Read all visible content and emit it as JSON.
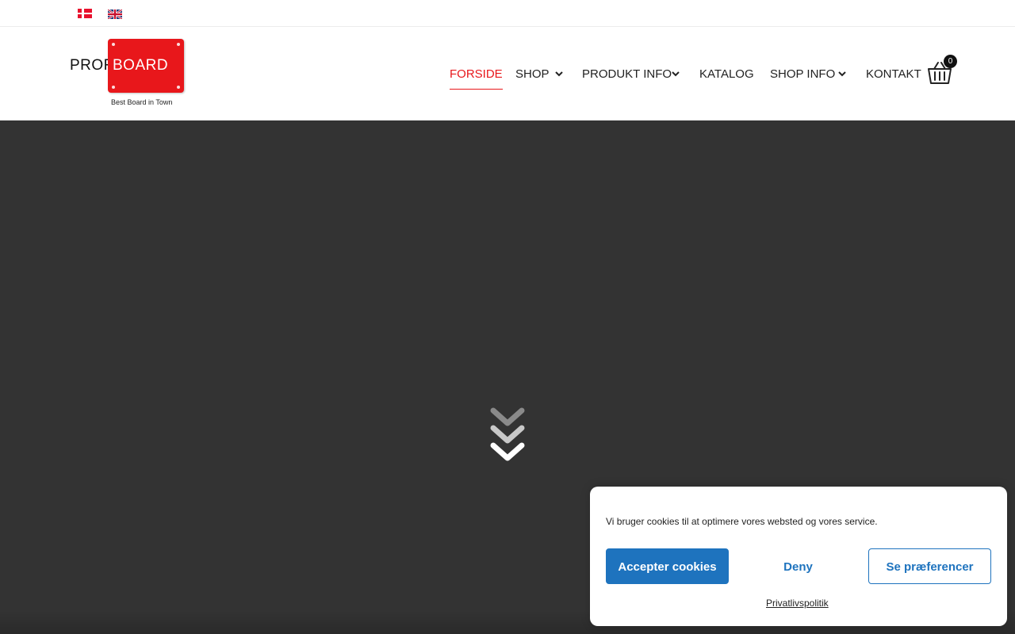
{
  "languages": [
    {
      "code": "da",
      "icon": "danish-flag-icon"
    },
    {
      "code": "en",
      "icon": "uk-flag-icon"
    }
  ],
  "logo": {
    "prefix": "PROF",
    "board": "BOARD",
    "tagline": "Best Board in Town",
    "brand_color": "#e8171b"
  },
  "nav": {
    "items": [
      {
        "label": "FORSIDE",
        "active": true,
        "dropdown": false
      },
      {
        "label": "SHOP",
        "active": false,
        "dropdown": true
      },
      {
        "label": "PRODUKT INFO",
        "active": false,
        "dropdown": true
      },
      {
        "label": "KATALOG",
        "active": false,
        "dropdown": false
      },
      {
        "label": "SHOP INFO",
        "active": false,
        "dropdown": true
      },
      {
        "label": "KONTAKT",
        "active": false,
        "dropdown": false
      }
    ],
    "active_color": "#e8171b"
  },
  "cart": {
    "count": "0",
    "icon": "basket-icon"
  },
  "hero": {
    "background": "#333333",
    "icon": "double-chevron-down-icon"
  },
  "cookie_banner": {
    "message": "Vi bruger cookies til at optimere vores websted og vores service.",
    "accept_label": "Accepter cookies",
    "deny_label": "Deny",
    "preferences_label": "Se præferencer",
    "policy_link": "Privatlivspolitik",
    "accent_color": "#1e73be"
  }
}
